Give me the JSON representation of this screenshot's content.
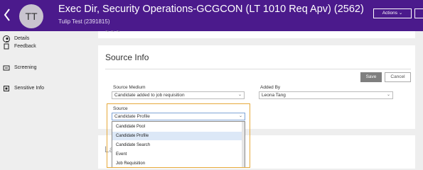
{
  "header": {
    "back_icon": "chevron-left-icon",
    "avatar_initials": "TT",
    "title": "Exec Dir, Security Operations-GCGCON (LT 1010 Req Apv) (2562)",
    "subtitle": "Tulip Test (2391815)",
    "actions_label": "Actions",
    "actions_icon": "chevron-down-icon",
    "background": "#4b1a8c"
  },
  "sidebar": {
    "items": [
      {
        "label": "Details",
        "icon": "person-icon"
      },
      {
        "label": "Feedback",
        "icon": "feedback-icon"
      },
      {
        "label": "Screening",
        "icon": "screening-icon"
      },
      {
        "label": "Sensitive Info",
        "icon": "sensitive-info-icon"
      }
    ]
  },
  "source_info": {
    "heading": "Source Info",
    "save_label": "Save",
    "cancel_label": "Cancel",
    "source_medium": {
      "label": "Source Medium",
      "value": "Candidate added to job requisition"
    },
    "added_by": {
      "label": "Added By",
      "value": "Leona Tang"
    },
    "source": {
      "label": "Source",
      "value": "Candidate Profile",
      "options": [
        "Candidate Pool",
        "Candidate Profile",
        "Candidate Search",
        "Event",
        "Job Requisition"
      ],
      "hovered_option": "Candidate Profile"
    }
  },
  "next_section": {
    "heading_partial": "La"
  },
  "colors": {
    "accent": "#4b1a8c",
    "highlight": "#e6a93a",
    "hover": "#dce8f7"
  }
}
